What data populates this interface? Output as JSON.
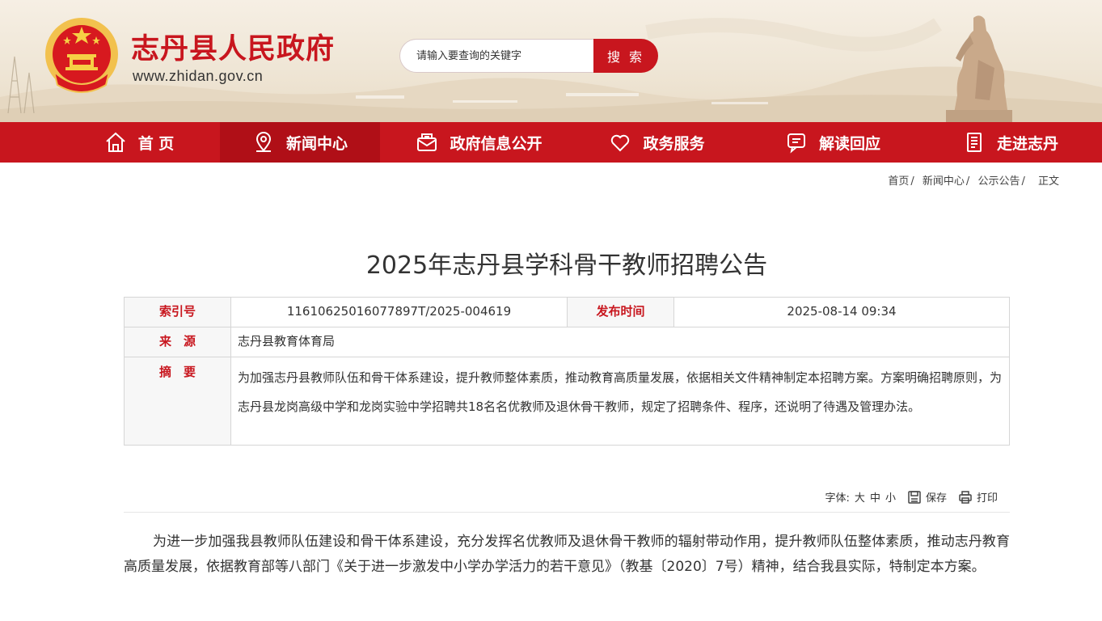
{
  "header": {
    "site_title": "志丹县人民政府",
    "site_url": "www.zhidan.gov.cn",
    "search_placeholder": "请输入要查询的关键字",
    "search_button": "搜 索"
  },
  "nav": {
    "items": [
      {
        "label": "首 页",
        "icon": "home-icon"
      },
      {
        "label": "新闻中心",
        "icon": "location-pin-icon",
        "active": true
      },
      {
        "label": "政府信息公开",
        "icon": "envelope-icon"
      },
      {
        "label": "政务服务",
        "icon": "heart-icon"
      },
      {
        "label": "解读回应",
        "icon": "chat-icon"
      },
      {
        "label": "走进志丹",
        "icon": "document-icon"
      }
    ]
  },
  "breadcrumb": [
    "首页",
    "新闻中心",
    "公示公告",
    "正文"
  ],
  "article": {
    "title": "2025年志丹县学科骨干教师招聘公告",
    "index_label": "索引号",
    "index_value": "11610625016077897T/2025-004619",
    "date_label": "发布时间",
    "date_value": "2025-08-14 09:34",
    "source_label": "来　源",
    "source_value": "志丹县教育体育局",
    "summary_label": "摘　要",
    "summary_value": "为加强志丹县教师队伍和骨干体系建设，提升教师整体素质，推动教育高质量发展，依据相关文件精神制定本招聘方案。方案明确招聘原则，为志丹县龙岗高级中学和龙岗实验中学招聘共18名名优教师及退休骨干教师，规定了招聘条件、程序，还说明了待遇及管理办法。",
    "paragraph_1": "为进一步加强我县教师队伍建设和骨干体系建设，充分发挥名优教师及退休骨干教师的辐射带动作用，提升教师队伍整体素质，推动志丹教育高质量发展，依据教育部等八部门《关于进一步激发中小学办学活力的若干意见》（教基〔2020〕7号）精神，结合我县实际，特制定本方案。"
  },
  "tools": {
    "font_label": "字体:",
    "font_large": "大",
    "font_medium": "中",
    "font_small": "小",
    "save": "保存",
    "print": "打印"
  },
  "colors": {
    "brand_red": "#c8161e",
    "nav_active": "#b00f17"
  }
}
